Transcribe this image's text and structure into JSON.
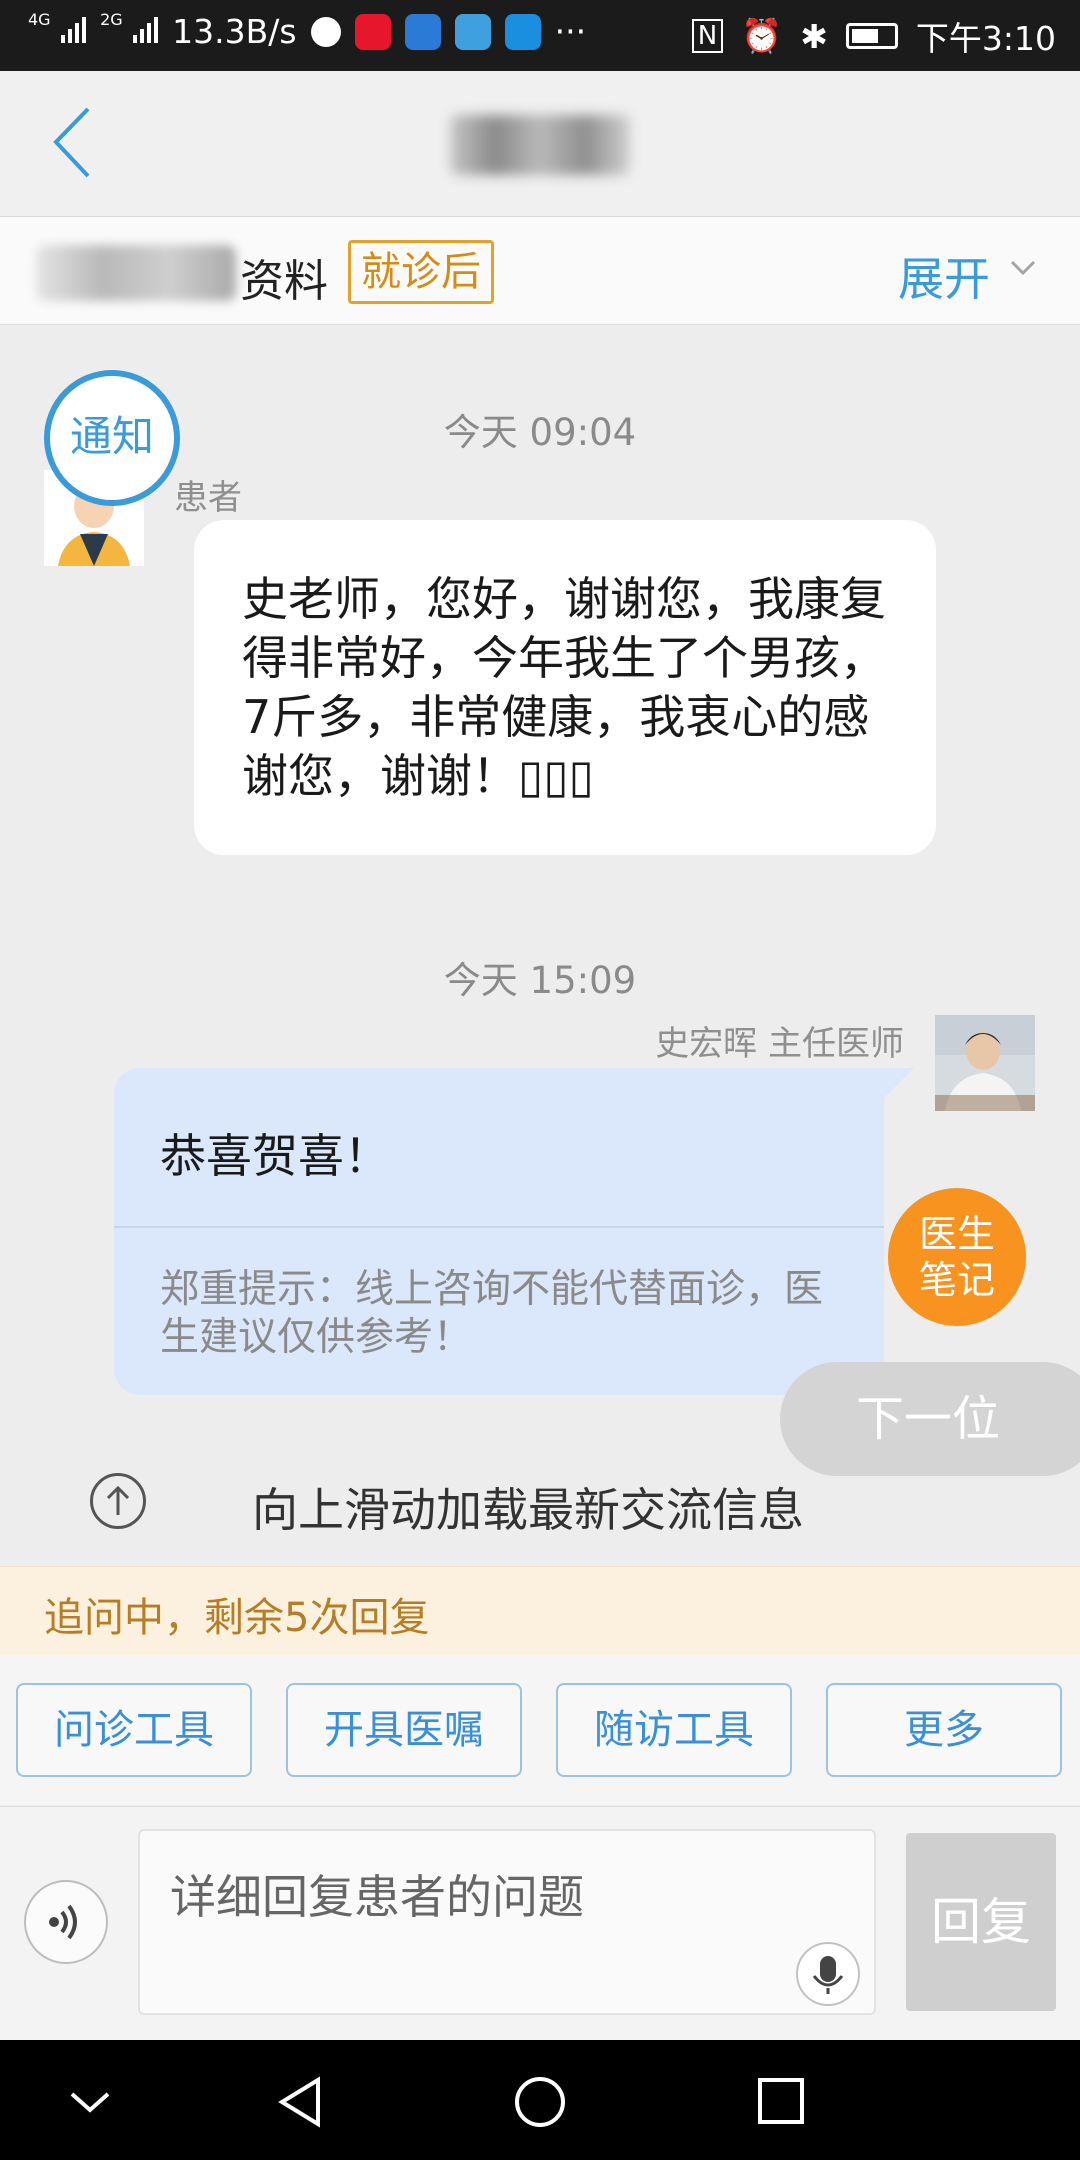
{
  "status_bar": {
    "net1": "4G",
    "net2": "2G",
    "speed": "13.3B/s",
    "more": "···",
    "nfc": "N",
    "time": "下午3:10",
    "app_icons": [
      "wechat-icon",
      "weibo-icon",
      "app-icon",
      "app-icon",
      "alipay-icon"
    ]
  },
  "profile": {
    "label": "资料",
    "badge": "就诊后",
    "expand": "展开"
  },
  "chat": {
    "ts1": "今天 09:04",
    "notify_badge": "通知",
    "patient_label": "患者",
    "patient_message": "史老师，您好，谢谢您，我康复得非常好，今年我生了个男孩，7斤多，非常健康，我衷心的感谢您，谢谢！▯▯▯",
    "ts2": "今天 15:09",
    "doctor_label": "史宏晖 主任医师",
    "doctor_message": "恭喜贺喜！",
    "doctor_hint": "郑重提示：线上咨询不能代替面诊，医生建议仅供参考！",
    "doctor_note_button": "医生笔记",
    "next_button": "下一位"
  },
  "load_more": "向上滑动加载最新交流信息",
  "followup": "追问中，剩余5次回复",
  "toolbar": {
    "buttons": [
      "问诊工具",
      "开具医嘱",
      "随访工具",
      "更多"
    ]
  },
  "input": {
    "placeholder": "详细回复患者的问题",
    "reply_label": "回复"
  },
  "colors": {
    "accent": "#3b9ad8",
    "badge": "#d48c14",
    "orange": "#f7931e",
    "doctor_bubble": "#dbe7fb"
  }
}
